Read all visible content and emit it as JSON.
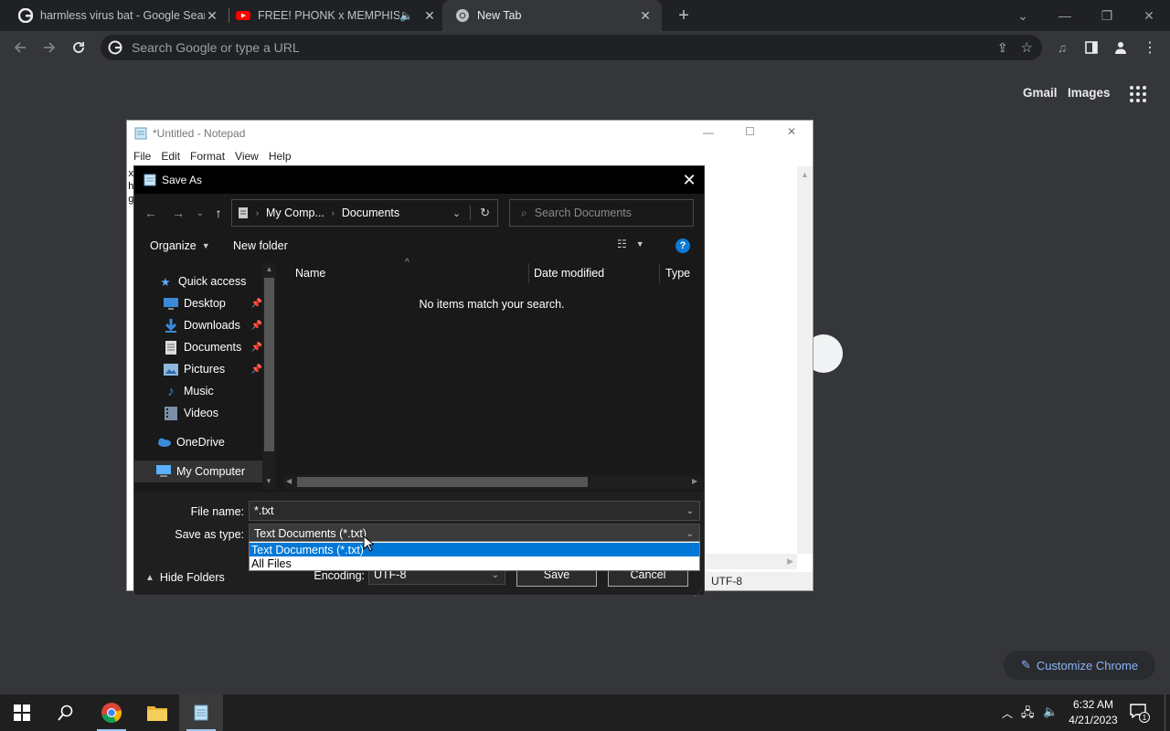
{
  "browser": {
    "tabs": [
      {
        "title": "harmless virus bat - Google Sear",
        "favicon": "google-g-icon",
        "active": false
      },
      {
        "title": "FREE! PHONK x MEMPHIS $",
        "favicon": "youtube-icon",
        "active": false,
        "audio": true
      },
      {
        "title": "New Tab",
        "favicon": "chrome-icon",
        "active": true
      }
    ],
    "omnibox_placeholder": "Search Google or type a URL",
    "ntp": {
      "gmail": "Gmail",
      "images": "Images",
      "customize": "Customize Chrome"
    }
  },
  "notepad": {
    "title": "*Untitled - Notepad",
    "menu": [
      "File",
      "Edit",
      "Format",
      "View",
      "Help"
    ],
    "text_lines": [
      "x",
      "h",
      "g"
    ],
    "encoding_status": "UTF-8"
  },
  "dialog": {
    "title": "Save As",
    "breadcrumb": [
      "My Comp...",
      "Documents"
    ],
    "search_placeholder": "Search Documents",
    "organize": "Organize",
    "new_folder": "New folder",
    "nav": {
      "quick_access": "Quick access",
      "items": [
        {
          "label": "Desktop",
          "icon": "desktop-icon",
          "pinned": true
        },
        {
          "label": "Downloads",
          "icon": "downloads-icon",
          "pinned": true
        },
        {
          "label": "Documents",
          "icon": "documents-icon",
          "pinned": true
        },
        {
          "label": "Pictures",
          "icon": "pictures-icon",
          "pinned": true
        },
        {
          "label": "Music",
          "icon": "music-icon",
          "pinned": false
        },
        {
          "label": "Videos",
          "icon": "videos-icon",
          "pinned": false
        }
      ],
      "onedrive": "OneDrive",
      "my_computer": "My Computer"
    },
    "columns": {
      "name": "Name",
      "date": "Date modified",
      "type": "Type"
    },
    "empty_message": "No items match your search.",
    "file_name_label": "File name:",
    "file_name_value": "*.txt",
    "save_type_label": "Save as type:",
    "save_type_value": "Text Documents (*.txt)",
    "save_type_options": [
      "Text Documents (*.txt)",
      "All Files"
    ],
    "encoding_label": "Encoding:",
    "encoding_value": "UTF-8",
    "hide_folders": "Hide Folders",
    "save": "Save",
    "cancel": "Cancel"
  },
  "taskbar": {
    "time": "6:32 AM",
    "date": "4/21/2023",
    "notifications": "1"
  },
  "colors": {
    "chrome_bg": "#35363a",
    "accent_blue": "#0078d7",
    "link_blue": "#8ab4f8"
  }
}
